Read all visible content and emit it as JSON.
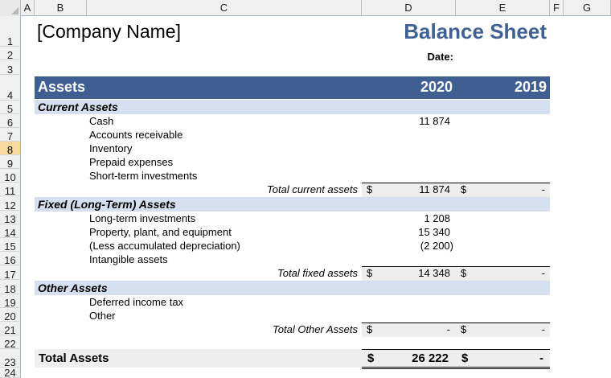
{
  "columns": [
    "A",
    "B",
    "C",
    "D",
    "E",
    "F",
    "G"
  ],
  "rows": [
    "1",
    "2",
    "3",
    "4",
    "5",
    "6",
    "7",
    "8",
    "9",
    "10",
    "11",
    "12",
    "13",
    "14",
    "15",
    "16",
    "17",
    "18",
    "19",
    "20",
    "21",
    "22",
    "23",
    "24"
  ],
  "selected_row": "8",
  "header": {
    "company": "[Company Name]",
    "title": "Balance Sheet",
    "date_label": "Date:"
  },
  "table": {
    "section_title": "Assets",
    "year_current": "2020",
    "year_prior": "2019",
    "currency": "$",
    "current_assets": {
      "title": "Current Assets",
      "items": [
        {
          "label": "Cash",
          "v2020": "11 874",
          "v2019": ""
        },
        {
          "label": "Accounts receivable",
          "v2020": "",
          "v2019": ""
        },
        {
          "label": "Inventory",
          "v2020": "",
          "v2019": ""
        },
        {
          "label": "Prepaid expenses",
          "v2020": "",
          "v2019": ""
        },
        {
          "label": "Short-term investments",
          "v2020": "",
          "v2019": ""
        }
      ],
      "total_label": "Total current assets",
      "total_2020": "11 874",
      "total_2019": "-"
    },
    "fixed_assets": {
      "title": "Fixed (Long-Term) Assets",
      "items": [
        {
          "label": "Long-term investments",
          "v2020": "1 208",
          "v2019": ""
        },
        {
          "label": "Property, plant, and equipment",
          "v2020": "15 340",
          "v2019": ""
        },
        {
          "label": "(Less accumulated depreciation)",
          "v2020": "(2 200)",
          "v2019": ""
        },
        {
          "label": "Intangible assets",
          "v2020": "",
          "v2019": ""
        }
      ],
      "total_label": "Total fixed assets",
      "total_2020": "14 348",
      "total_2019": "-"
    },
    "other_assets": {
      "title": "Other Assets",
      "items": [
        {
          "label": "Deferred income tax",
          "v2020": "",
          "v2019": ""
        },
        {
          "label": "Other",
          "v2020": "",
          "v2019": ""
        }
      ],
      "total_label": "Total Other Assets",
      "total_2020": "-",
      "total_2019": "-"
    },
    "grand_total": {
      "label": "Total Assets",
      "v2020": "26 222",
      "v2019": "-"
    }
  }
}
